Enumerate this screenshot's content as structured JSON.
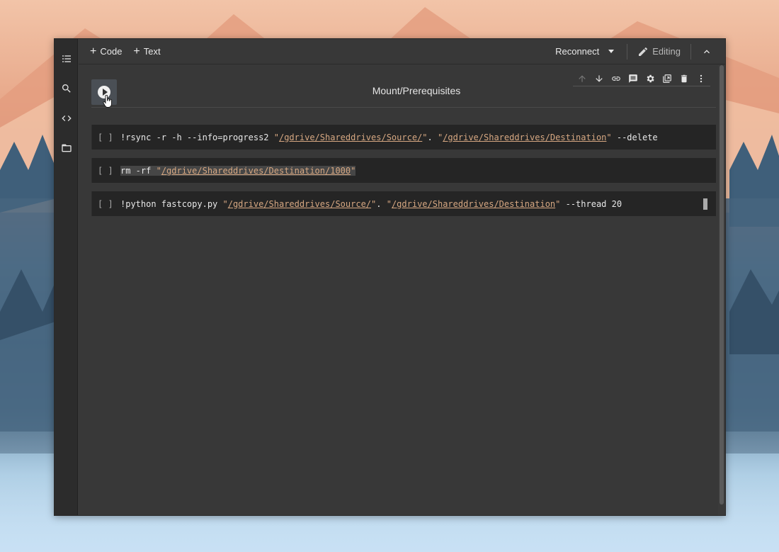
{
  "toolbar": {
    "add_code": "Code",
    "add_text": "Text",
    "reconnect": "Reconnect",
    "editing": "Editing"
  },
  "section": {
    "title": "Mount/Prerequisites"
  },
  "cells": [
    {
      "bracket": "[ ]",
      "cmd": "!rsync -r -h --info=progress2 ",
      "q1o": "\"",
      "path1": "/gdrive/Shareddrives/Source/",
      "q1c": "\"",
      "mid": ". ",
      "q2o": "\"",
      "path2": "/gdrive/Shareddrives/Destination",
      "q2c": "\"",
      "tail": " --delete"
    },
    {
      "bracket": "[ ]",
      "cmd": "rm -rf ",
      "q1o": "\"",
      "path1": "/gdrive/Shareddrives/Destination/1000",
      "q1c": "\""
    },
    {
      "bracket": "[ ]",
      "cmd": "!python fastcopy.py ",
      "q1o": "\"",
      "path1": "/gdrive/Shareddrives/Source/",
      "q1c": "\"",
      "mid": ". ",
      "q2o": "\"",
      "path2": "/gdrive/Shareddrives/Destination",
      "q2c": "\"",
      "tail": " --thread 20"
    }
  ],
  "icons": {
    "rail": [
      "table-of-contents-icon",
      "search-icon",
      "code-snippets-icon",
      "folder-icon"
    ],
    "cell_toolbar": [
      "arrow-up-icon",
      "arrow-down-icon",
      "link-icon",
      "comment-icon",
      "gear-icon",
      "mirror-cell-icon",
      "trash-icon",
      "more-vert-icon"
    ]
  }
}
